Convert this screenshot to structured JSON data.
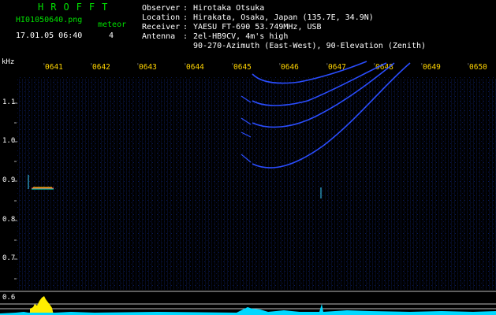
{
  "logo": "HROFFT",
  "file": {
    "name": "HI01050640.png",
    "datetime": "17.01.05 06:40"
  },
  "meteor": {
    "label": "meteor",
    "count": "4"
  },
  "station": {
    "observer_label": "Observer",
    "observer": "Hirotaka Otsuka",
    "location_label": "Location",
    "location": "Hirakata, Osaka, Japan (135.7E, 34.9N)",
    "receiver_label": "Receiver",
    "receiver": "YAESU FT-690 53.749MHz, USB",
    "antenna_label": "Antenna",
    "antenna": "2el-HB9CV, 4m's high",
    "antenna_line2": "90-270-Azimuth (East-West), 90-Elevation (Zenith)"
  },
  "axis": {
    "y_unit": "kHz",
    "y_ticks": [
      "1.1",
      "1.0",
      "0.9",
      "0.8",
      "0.7",
      "0.6"
    ],
    "x_ticks": [
      "0641",
      "0642",
      "0643",
      "0644",
      "0645",
      "0646",
      "0647",
      "0648",
      "0649",
      "0650"
    ]
  },
  "colors": {
    "text": "#ffffff",
    "label_green": "#00e000",
    "time_yellow": "#ffd400",
    "trace_blue": "#2a4dff",
    "level_yellow": "#ffee00",
    "level_cyan": "#00e0ff"
  }
}
